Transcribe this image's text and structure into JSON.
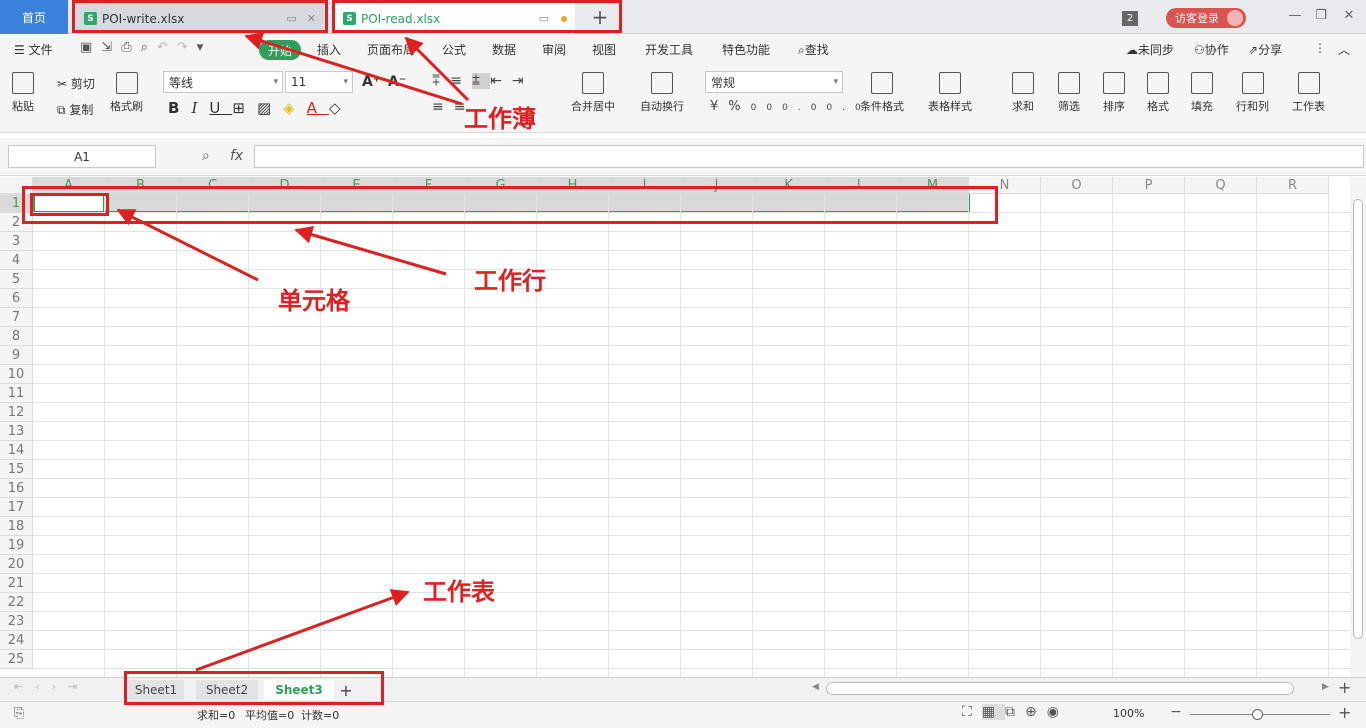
{
  "tabs": {
    "home": "首页",
    "doc1": {
      "name": "POI-write.xlsx",
      "icon": "S"
    },
    "doc2": {
      "name": "POI-read.xlsx",
      "icon": "S"
    },
    "new_tab": "+",
    "window_count": "2",
    "login": "访客登录"
  },
  "menu": {
    "file": "文件",
    "start": "开始",
    "items": [
      "插入",
      "页面布局",
      "公式",
      "数据",
      "审阅",
      "视图",
      "开发工具",
      "特色功能"
    ],
    "search": "查找",
    "right": [
      "未同步",
      "协作",
      "分享"
    ]
  },
  "ribbon": {
    "paste": "粘贴",
    "cut": "剪切",
    "copy": "复制",
    "format_painter": "格式刷",
    "font_name": "等线",
    "font_size": "11",
    "merge_center": "合并居中",
    "wrap_text": "自动换行",
    "number_format": "常规",
    "conditional_format": "条件格式",
    "table_style": "表格样式",
    "sum": "求和",
    "filter": "筛选",
    "sort": "排序",
    "format": "格式",
    "fill": "填充",
    "row_col": "行和列",
    "worksheet": "工作表"
  },
  "formula": {
    "name_box": "A1",
    "fx": "fx",
    "value": ""
  },
  "grid": {
    "columns": [
      "A",
      "B",
      "C",
      "D",
      "E",
      "F",
      "G",
      "H",
      "I",
      "J",
      "K",
      "L",
      "M",
      "N",
      "O",
      "P",
      "Q",
      "R"
    ],
    "rows": [
      "1",
      "2",
      "3",
      "4",
      "5",
      "6",
      "7",
      "8",
      "9",
      "10",
      "11",
      "12",
      "13",
      "14",
      "15",
      "16",
      "17",
      "18",
      "19",
      "20",
      "21",
      "22",
      "23",
      "24",
      "25"
    ]
  },
  "sheets": [
    "Sheet1",
    "Sheet2",
    "Sheet3"
  ],
  "active_sheet": "Sheet3",
  "status": {
    "sum": "求和=0",
    "avg": "平均值=0",
    "count": "计数=0",
    "zoom": "100%"
  },
  "annotations": {
    "workbook": "工作薄",
    "row": "工作行",
    "cell": "单元格",
    "sheet": "工作表"
  },
  "colors": {
    "accent": "#2f9e5a",
    "annotation": "#e02020",
    "home_tab": "#3c82dc"
  }
}
